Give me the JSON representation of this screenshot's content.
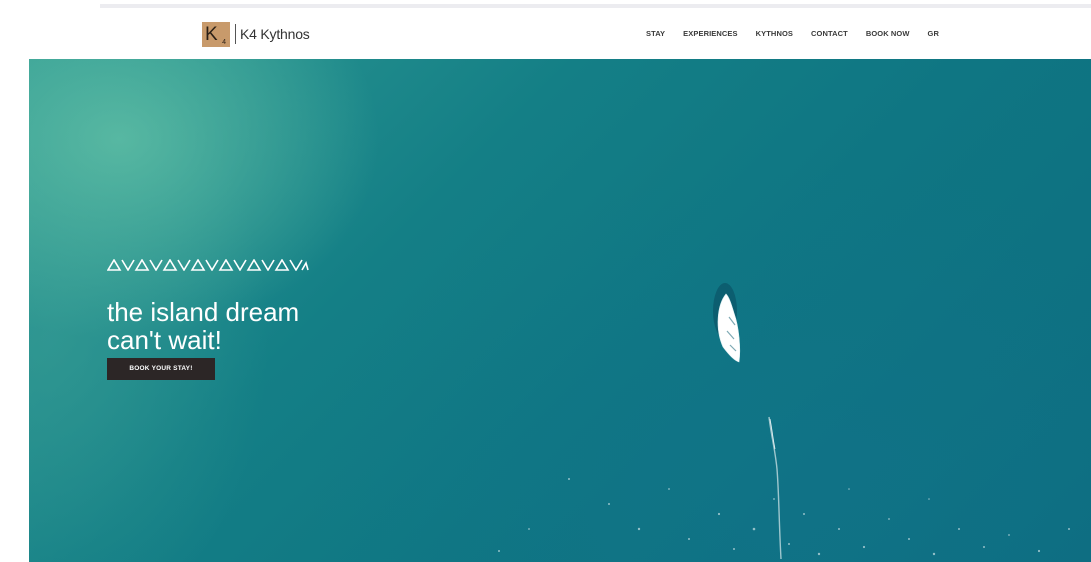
{
  "brand": {
    "logo_letter": "K",
    "logo_sub": "4",
    "name": "K4 Kythnos"
  },
  "nav": {
    "items": [
      "STAY",
      "EXPERIENCES",
      "KYTHNOS",
      "CONTACT",
      "BOOK NOW",
      "GR"
    ]
  },
  "hero": {
    "title_line1": "the island dream",
    "title_line2": "can't wait!",
    "cta_label": "BOOK YOUR STAY!"
  },
  "colors": {
    "logo_tile": "#c89a6b",
    "cta_background": "#2c2626",
    "sea": "#147f86",
    "header": "#ffffff"
  },
  "icons": {
    "hero_ornament": "zigzag-ornament-icon",
    "boat": "boat-icon"
  }
}
